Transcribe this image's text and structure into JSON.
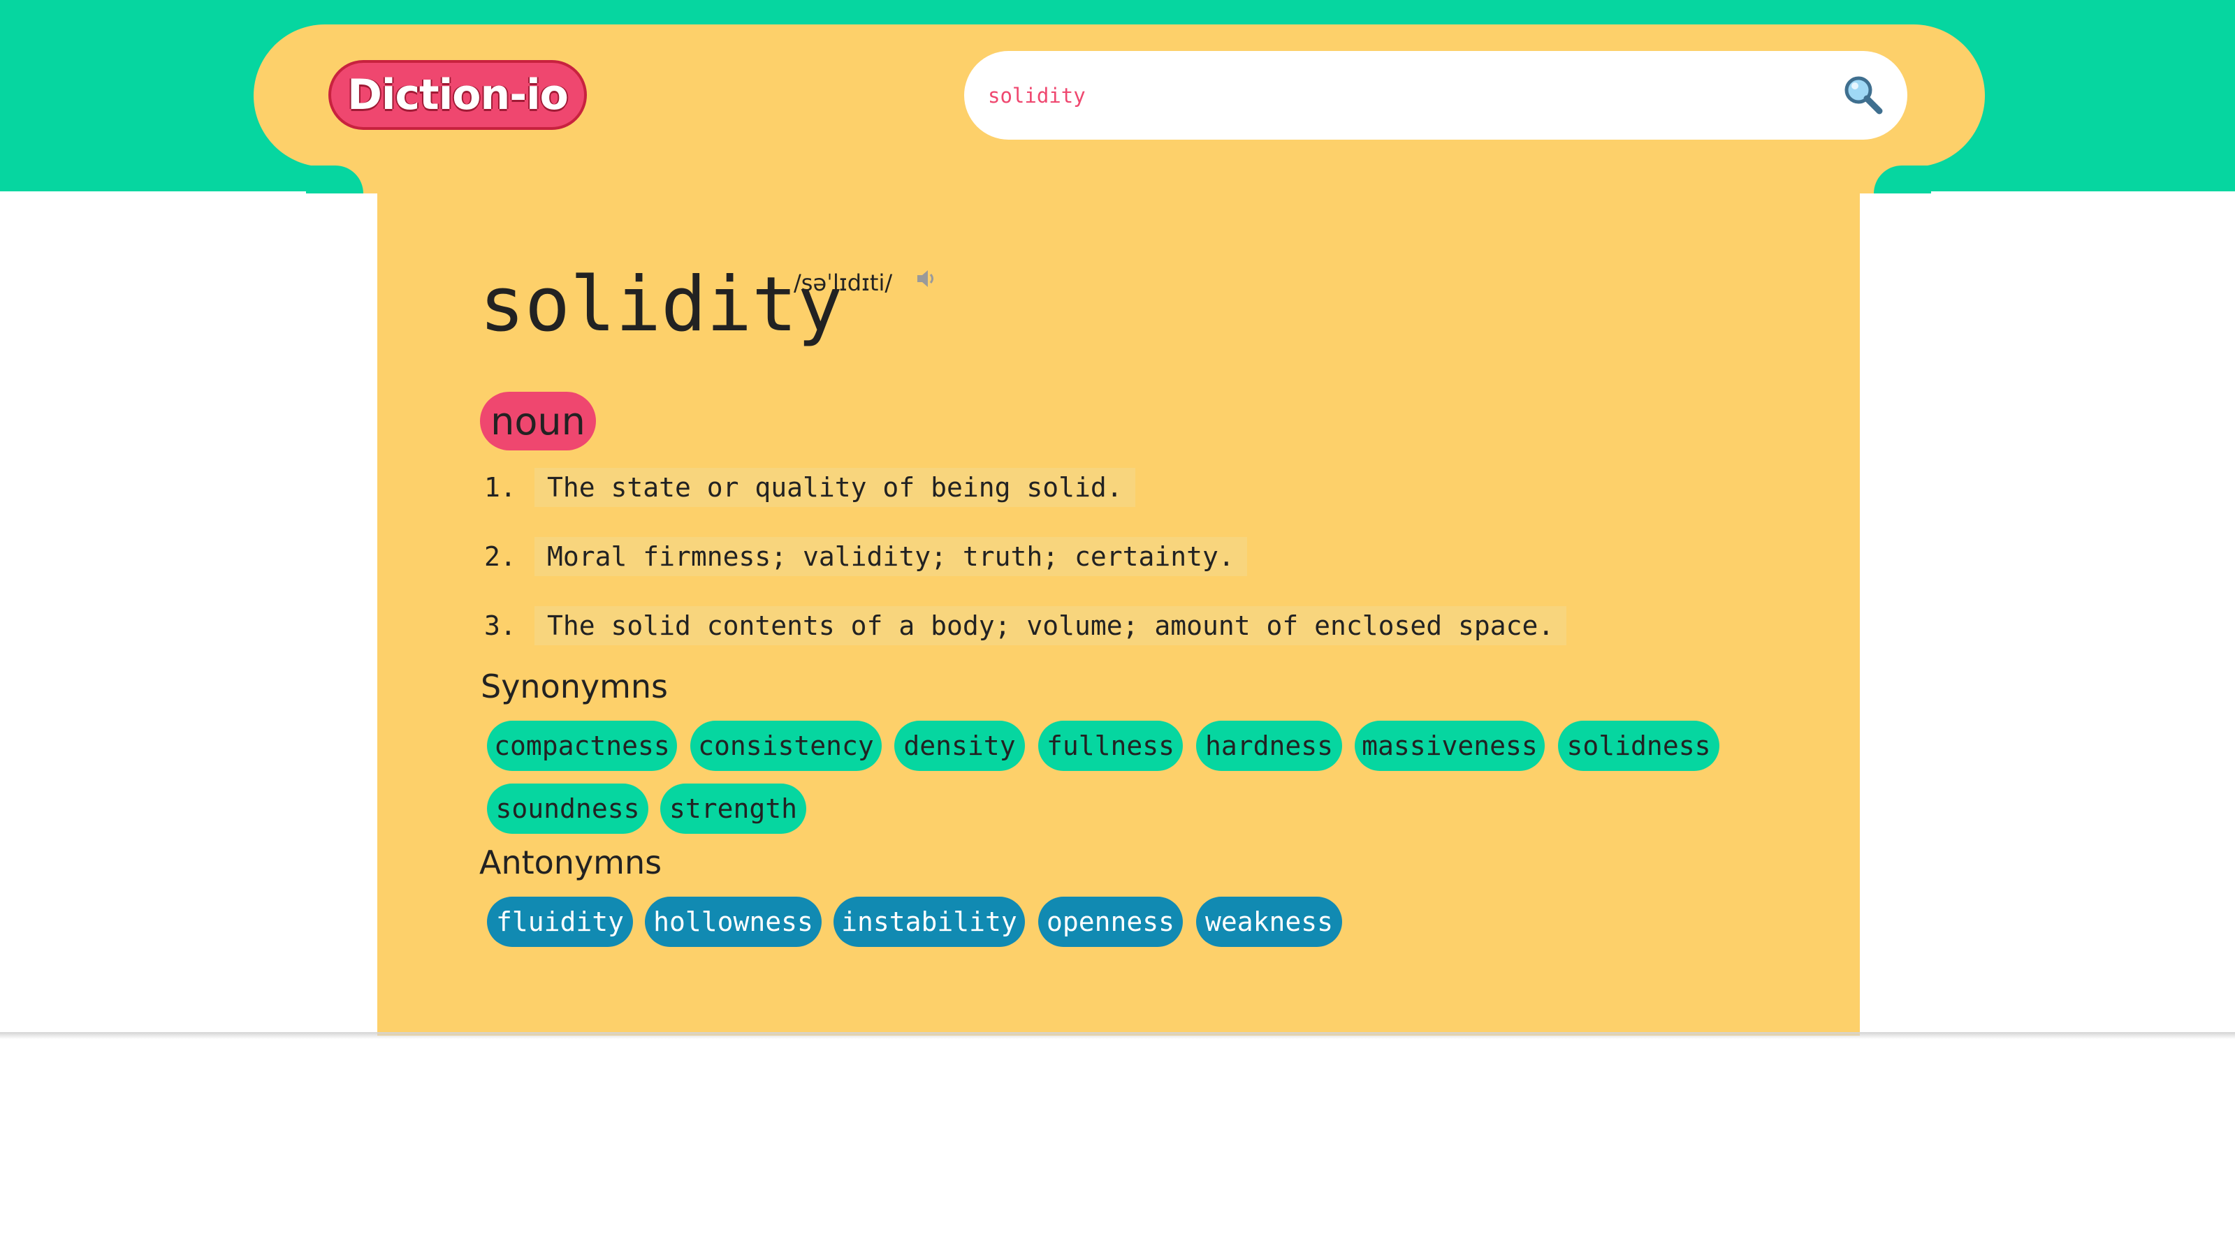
{
  "brand": {
    "logo_text": "Diction-io"
  },
  "search": {
    "value": "solidity",
    "icon": "magnifier-icon"
  },
  "entry": {
    "word": "solidity",
    "phonetic": "/səˈlɪdɪti/",
    "audio_icon": "speaker-icon",
    "part_of_speech": "noun",
    "definitions": [
      {
        "number": "1.",
        "text": "The state or quality of being solid."
      },
      {
        "number": "2.",
        "text": "Moral firmness; validity; truth; certainty."
      },
      {
        "number": "3.",
        "text": "The solid contents of a body; volume; amount of enclosed space."
      }
    ],
    "synonyms_title": "Synonymns",
    "synonyms": [
      "compactness",
      "consistency",
      "density",
      "fullness",
      "hardness",
      "massiveness",
      "solidness",
      "soundness",
      "strength"
    ],
    "antonyms_title": "Antonymns",
    "antonyms": [
      "fluidity",
      "hollowness",
      "instability",
      "openness",
      "weakness"
    ]
  },
  "colors": {
    "green": "#06d6a0",
    "yellow": "#fdd06a",
    "pink": "#ef476f",
    "blue": "#118ab2"
  }
}
